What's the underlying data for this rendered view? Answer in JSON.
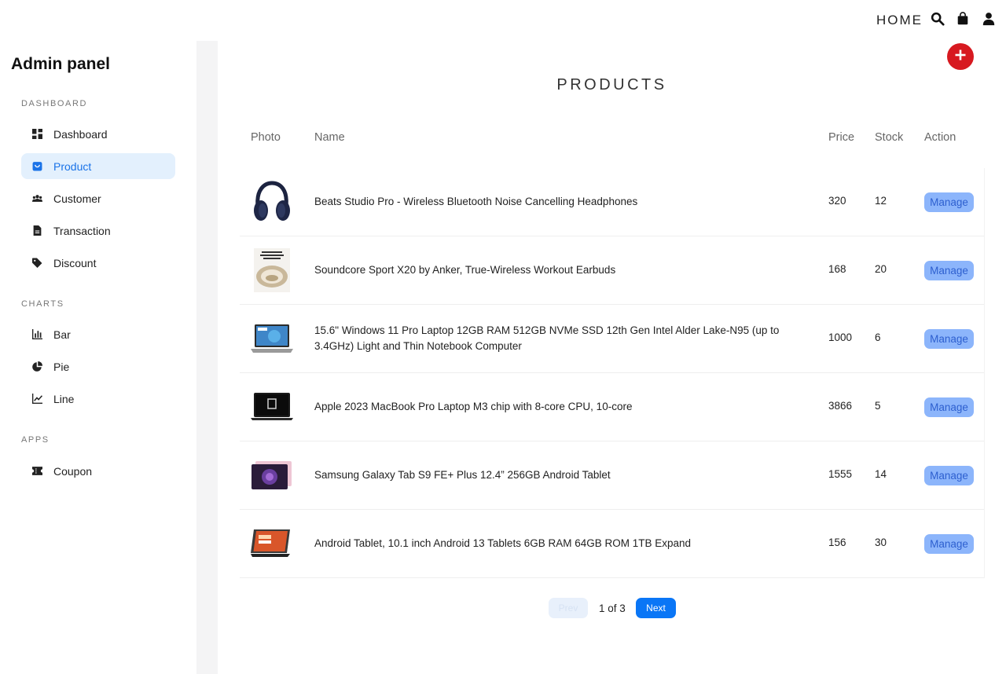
{
  "topbar": {
    "home_label": "HOME",
    "icons": [
      "search-icon",
      "shopping-bag-icon",
      "user-icon"
    ]
  },
  "sidebar": {
    "title": "Admin panel",
    "sections": [
      {
        "label": "DASHBOARD",
        "items": [
          {
            "label": "Dashboard",
            "icon": "dashboard-icon",
            "active": false
          },
          {
            "label": "Product",
            "icon": "bag-icon",
            "active": true
          },
          {
            "label": "Customer",
            "icon": "people-icon",
            "active": false
          },
          {
            "label": "Transaction",
            "icon": "document-icon",
            "active": false
          },
          {
            "label": "Discount",
            "icon": "tag-icon",
            "active": false
          }
        ]
      },
      {
        "label": "CHARTS",
        "items": [
          {
            "label": "Bar",
            "icon": "bar-chart-icon",
            "active": false
          },
          {
            "label": "Pie",
            "icon": "pie-chart-icon",
            "active": false
          },
          {
            "label": "Line",
            "icon": "line-chart-icon",
            "active": false
          }
        ]
      },
      {
        "label": "APPS",
        "items": [
          {
            "label": "Coupon",
            "icon": "ticket-icon",
            "active": false
          }
        ]
      }
    ]
  },
  "main": {
    "title": "PRODUCTS",
    "add_icon": "plus-icon",
    "columns": [
      "Photo",
      "Name",
      "Price",
      "Stock",
      "Action"
    ],
    "rows": [
      {
        "photo": "headphones",
        "name": "Beats Studio Pro - Wireless Bluetooth Noise Cancelling Headphones",
        "price": "320",
        "stock": "12",
        "action": "Manage"
      },
      {
        "photo": "earbuds",
        "name": "Soundcore Sport X20 by Anker, True-Wireless Workout Earbuds",
        "price": "168",
        "stock": "20",
        "action": "Manage"
      },
      {
        "photo": "laptop",
        "name": "15.6\" Windows 11 Pro Laptop 12GB RAM 512GB NVMe SSD 12th Gen Intel Alder Lake-N95 (up to 3.4GHz) Light and Thin Notebook Computer",
        "price": "1000",
        "stock": "6",
        "action": "Manage"
      },
      {
        "photo": "macbook",
        "name": "Apple 2023 MacBook Pro Laptop M3 chip with 8-core CPU, 10-core",
        "price": "3866",
        "stock": "5",
        "action": "Manage"
      },
      {
        "photo": "galaxy-tab",
        "name": "Samsung Galaxy Tab S9 FE+ Plus 12.4” 256GB Android Tablet",
        "price": "1555",
        "stock": "14",
        "action": "Manage"
      },
      {
        "photo": "android-tablet",
        "name": "Android Tablet, 10.1 inch Android 13 Tablets 6GB RAM 64GB ROM 1TB Expand",
        "price": "156",
        "stock": "30",
        "action": "Manage"
      }
    ],
    "pagination": {
      "prev_label": "Prev",
      "page_info": "1 of 3",
      "next_label": "Next"
    }
  },
  "colors": {
    "accent": "#1a73e8",
    "active_bg": "#e3f0fd",
    "add_button": "#d71920",
    "manage_bg": "#8cb5fb",
    "next_bg": "#0a76f6"
  }
}
